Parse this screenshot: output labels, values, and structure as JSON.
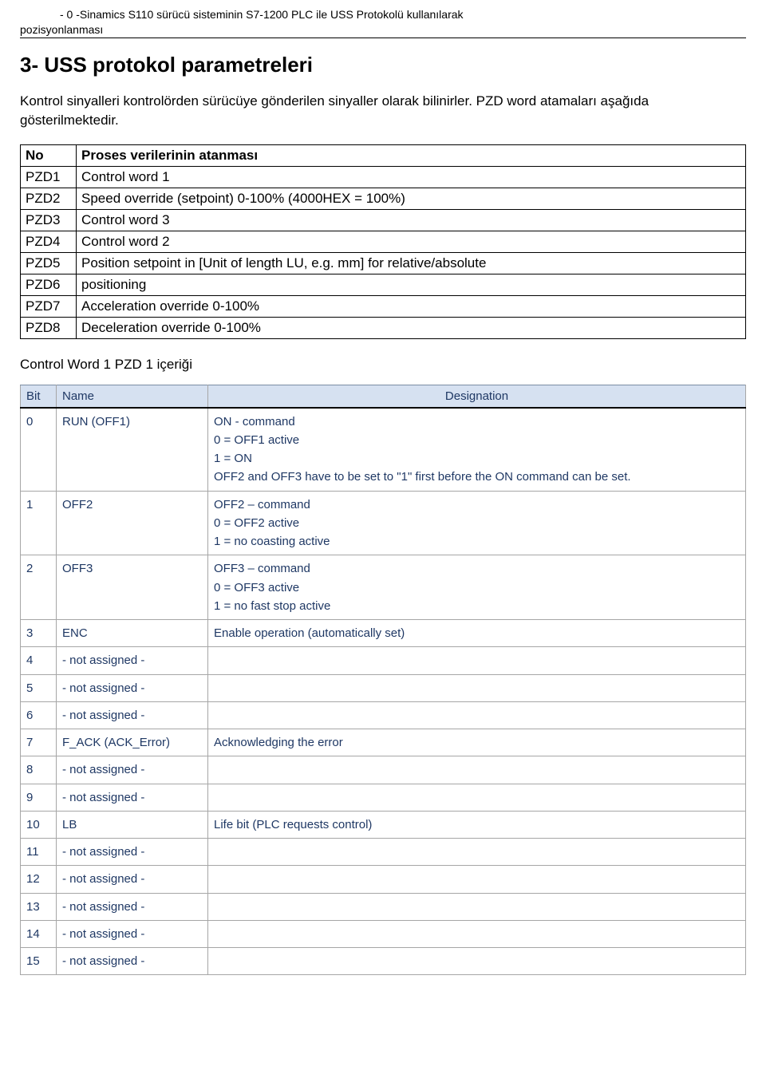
{
  "header": {
    "title": "- 0 -Sinamics S110 sürücü sisteminin S7-1200 PLC ile USS Protokolü kullanılarak",
    "subtitle": "pozisyonlanması"
  },
  "h1": "3- USS protokol parametreleri",
  "intro": "Kontrol sinyalleri kontrolörden sürücüye gönderilen sinyaller olarak bilinirler. PZD word atamaları aşağıda gösterilmektedir.",
  "pzd_table": {
    "headers": {
      "no": "No",
      "desc": "Proses verilerinin atanması"
    },
    "rows": [
      {
        "no": "PZD1",
        "desc": "Control word 1"
      },
      {
        "no": "PZD2",
        "desc": "Speed override (setpoint) 0-100% (4000HEX = 100%)"
      },
      {
        "no": "PZD3",
        "desc": "Control word 3"
      },
      {
        "no": "PZD4",
        "desc": "Control word 2"
      },
      {
        "no": "PZD5",
        "desc": "Position setpoint in [Unit of length LU, e.g. mm] for relative/absolute"
      },
      {
        "no": "PZD6",
        "desc": "positioning"
      },
      {
        "no": "PZD7",
        "desc": "Acceleration override 0-100%"
      },
      {
        "no": "PZD8",
        "desc": "Deceleration override 0-100%"
      }
    ]
  },
  "section_title": "Control Word 1 PZD 1 içeriği",
  "cw1_table": {
    "headers": {
      "bit": "Bit",
      "name": "Name",
      "designation": "Designation"
    },
    "rows": [
      {
        "bit": "0",
        "name": "RUN (OFF1)",
        "designation": "ON - command\n0 = OFF1 active\n1 = ON\nOFF2 and OFF3 have to be set to \"1\" first before the ON command can be set."
      },
      {
        "bit": "1",
        "name": "OFF2",
        "designation": "OFF2 – command\n0 = OFF2 active\n1 = no coasting active"
      },
      {
        "bit": "2",
        "name": "OFF3",
        "designation": "OFF3 – command\n0 = OFF3 active\n1 = no fast stop active"
      },
      {
        "bit": "3",
        "name": "ENC",
        "designation": "Enable operation (automatically set)"
      },
      {
        "bit": "4",
        "name": "- not assigned -",
        "designation": ""
      },
      {
        "bit": "5",
        "name": "- not assigned -",
        "designation": ""
      },
      {
        "bit": "6",
        "name": "- not assigned -",
        "designation": ""
      },
      {
        "bit": "7",
        "name": "F_ACK (ACK_Error)",
        "designation": "Acknowledging the error"
      },
      {
        "bit": "8",
        "name": "- not assigned -",
        "designation": ""
      },
      {
        "bit": "9",
        "name": "- not assigned -",
        "designation": ""
      },
      {
        "bit": "10",
        "name": "LB",
        "designation": "Life bit (PLC requests control)"
      },
      {
        "bit": "11",
        "name": "- not assigned -",
        "designation": ""
      },
      {
        "bit": "12",
        "name": "- not assigned -",
        "designation": ""
      },
      {
        "bit": "13",
        "name": "- not assigned -",
        "designation": ""
      },
      {
        "bit": "14",
        "name": "- not assigned -",
        "designation": ""
      },
      {
        "bit": "15",
        "name": "- not assigned -",
        "designation": ""
      }
    ]
  }
}
